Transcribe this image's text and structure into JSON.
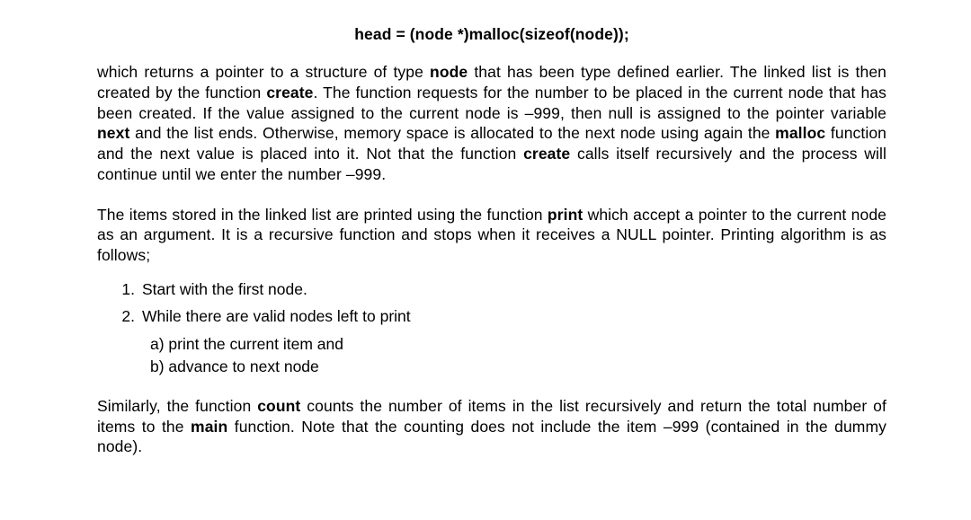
{
  "code_line": "head = (node *)malloc(sizeof(node));",
  "p1_a": "which returns a pointer to a structure of type ",
  "p1_b1": "node",
  "p1_c": " that has been type defined earlier.  The linked list is then created by the function ",
  "p1_b2": "create",
  "p1_d": ".  The function requests for the number to be placed in the current node that has been created.  If the value assigned to the current node is –999, then null is assigned to the pointer variable ",
  "p1_b3": "next",
  "p1_e": " and the list ends.  Otherwise, memory space is allocated to the next node using again the ",
  "p1_b4": "malloc",
  "p1_f": " function and the next value is placed into it.  Not that the function ",
  "p1_b5": "create",
  "p1_g": " calls itself recursively and the process will continue until we enter the number –999.",
  "p2_a": "The items stored in the linked list are printed using the function ",
  "p2_b1": "print",
  "p2_b": " which accept a pointer to the current node as an argument.  It is a recursive function and stops when it receives a NULL pointer.  Printing algorithm is as follows;",
  "list": {
    "1": "Start with the first node.",
    "2": "While there are valid nodes left to print",
    "2a": "a) print the current item and",
    "2b": "b) advance to next node"
  },
  "p3_a": "Similarly, the function ",
  "p3_b1": "count",
  "p3_b": " counts the number of items in the list recursively and return the total number of items to the ",
  "p3_b2": "main",
  "p3_c": " function. Note that the counting does not include the item –999 (contained in the dummy node)."
}
